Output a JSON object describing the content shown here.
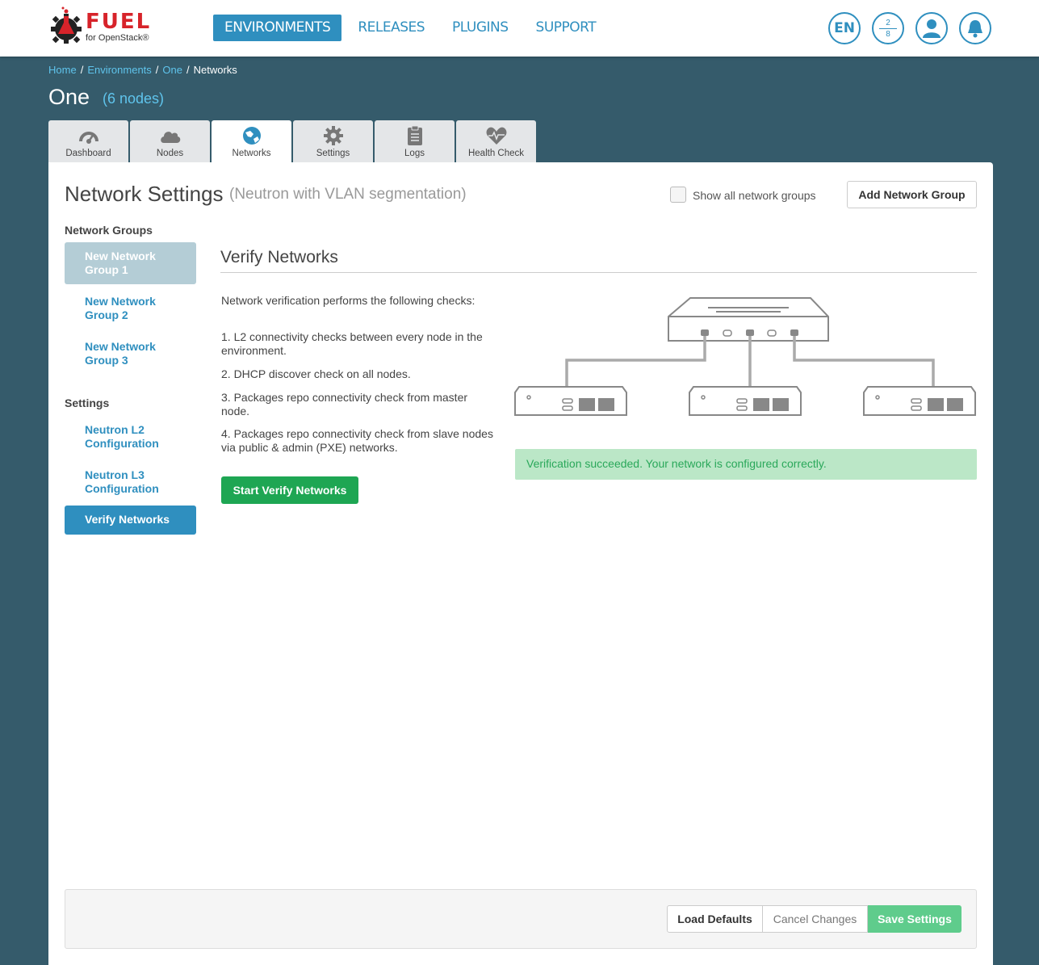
{
  "brand": {
    "name": "FUEL",
    "subtitle": "for OpenStack®"
  },
  "nav": [
    {
      "label": "ENVIRONMENTS",
      "active": true
    },
    {
      "label": "RELEASES",
      "active": false
    },
    {
      "label": "PLUGINS",
      "active": false
    },
    {
      "label": "SUPPORT",
      "active": false
    }
  ],
  "header_controls": {
    "language": "EN",
    "nodes_top": "2",
    "nodes_bottom": "8"
  },
  "breadcrumb": {
    "home": "Home",
    "environments": "Environments",
    "env": "One",
    "current": "Networks",
    "separator": "/"
  },
  "environment": {
    "name": "One",
    "nodes": "(6 nodes)"
  },
  "tabs": [
    {
      "label": "Dashboard",
      "icon": "gauge-icon"
    },
    {
      "label": "Nodes",
      "icon": "cloud-icon"
    },
    {
      "label": "Networks",
      "icon": "globe-icon",
      "active": true
    },
    {
      "label": "Settings",
      "icon": "gear-icon"
    },
    {
      "label": "Logs",
      "icon": "clipboard-icon"
    },
    {
      "label": "Health Check",
      "icon": "heart-pulse-icon"
    }
  ],
  "network_settings": {
    "title": "Network Settings",
    "subtitle": "(Neutron with VLAN segmentation)",
    "show_all_label": "Show all network groups",
    "add_group_button": "Add Network Group"
  },
  "sidebar": {
    "groups_heading": "Network Groups",
    "groups": [
      "New Network Group 1",
      "New Network Group 2",
      "New Network Group 3"
    ],
    "settings_heading": "Settings",
    "settings": [
      "Neutron L2 Configuration",
      "Neutron L3 Configuration",
      "Verify Networks"
    ]
  },
  "verify": {
    "title": "Verify Networks",
    "intro": "Network verification performs the following checks:",
    "checks": [
      "1. L2 connectivity checks between every node in the environment.",
      "2. DHCP discover check on all nodes.",
      "3. Packages repo connectivity check from master node.",
      "4. Packages repo connectivity check from slave nodes via public & admin (PXE) networks."
    ],
    "start_button": "Start Verify Networks",
    "result": "Verification succeeded. Your network is configured correctly."
  },
  "footer": {
    "load_defaults": "Load Defaults",
    "cancel_changes": "Cancel Changes",
    "save_settings": "Save Settings"
  },
  "colors": {
    "accent": "#2f8fbf",
    "background": "#355b6b",
    "success_bg": "#bbe7c7",
    "success_text": "#2aa85a",
    "start_button": "#1ea653",
    "save_button": "#5fcc8c"
  }
}
